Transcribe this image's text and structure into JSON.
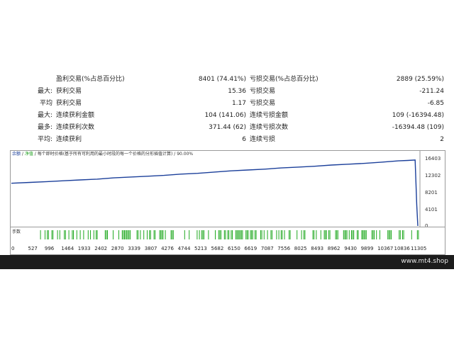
{
  "stats": {
    "rows": [
      {
        "prefix": "",
        "label1": "盈利交易(%占总百分比)",
        "value1": "8401 (74.41%)",
        "label2": "亏损交易(%占总百分比)",
        "value2": "2889 (25.59%)"
      },
      {
        "prefix": "最大:",
        "label1": "获利交易",
        "value1": "15.36",
        "label2": "亏损交易",
        "value2": "-211.24"
      },
      {
        "prefix": "平均",
        "label1": "获利交易",
        "value1": "1.17",
        "label2": "亏损交易",
        "value2": "-6.85"
      },
      {
        "prefix": "最大:",
        "label1": "连续获利金额",
        "value1": "104 (141.06)",
        "label2": "连续亏损金额",
        "value2": "109 (-16394.48)"
      },
      {
        "prefix": "最多:",
        "label1": "连续获利次数",
        "value1": "371.44 (62)",
        "label2": "连续亏损次数",
        "value2": "-16394.48 (109)"
      },
      {
        "prefix": "平均:",
        "label1": "连续获利",
        "value1": "6",
        "label2": "连续亏损",
        "value2": "2"
      }
    ]
  },
  "chart": {
    "title_balance": "余额",
    "title_sep1": " / ",
    "title_equity": "净值",
    "title_rest": " / 每个即时价格(基于所有可利用的最小时段的每一个价格的分形插值计算) / 90.00%",
    "deals_label": "手数",
    "colors": {
      "balance": "#1b3f9a",
      "deals": "#22aa22",
      "axis": "#9a9a9a"
    }
  },
  "chart_data": {
    "type": "line",
    "x": [
      0,
      527,
      996,
      1464,
      1933,
      2402,
      2870,
      3339,
      3807,
      4276,
      4744,
      5213,
      5682,
      6150,
      6619,
      7087,
      7556,
      8025,
      8493,
      8962,
      9430,
      9899,
      10367,
      10836,
      11100,
      11305,
      11350,
      11380
    ],
    "series": [
      {
        "values": [
          10300,
          10500,
          10700,
          10900,
          11100,
          11300,
          11600,
          11800,
          12000,
          12200,
          12500,
          12700,
          13000,
          13300,
          13500,
          13700,
          14000,
          14200,
          14400,
          14700,
          14900,
          15100,
          15400,
          15700,
          15800,
          15900,
          5000,
          0
        ]
      }
    ],
    "x_ticks": [
      "0",
      "527",
      "996",
      "1464",
      "1933",
      "2402",
      "2870",
      "3339",
      "3807",
      "4276",
      "4744",
      "5213",
      "5682",
      "6150",
      "6619",
      "7087",
      "7556",
      "8025",
      "8493",
      "8962",
      "9430",
      "9899",
      "10367",
      "10836",
      "11305"
    ],
    "y_ticks": [
      "16403",
      "12302",
      "8201",
      "4101",
      "0"
    ],
    "ylim": [
      0,
      16403
    ],
    "grid": false
  },
  "footer": {
    "watermark": "www.mt4.shop"
  }
}
